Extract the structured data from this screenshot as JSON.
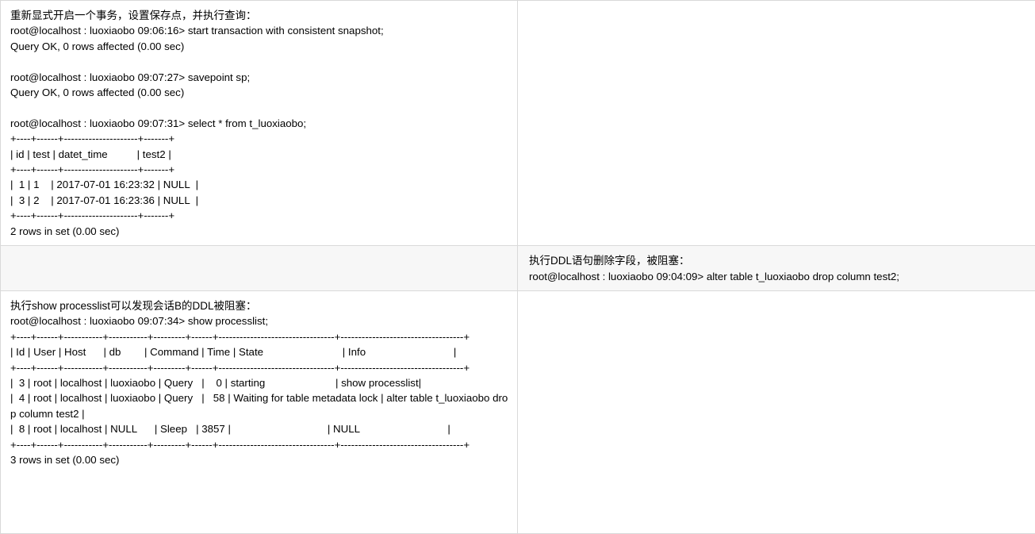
{
  "layout": {
    "kind": "two-column-comparison-table",
    "columns": [
      "session-a",
      "session-b"
    ],
    "rows": 3,
    "border_color": "#d9d9d9",
    "highlight_row_bg": "#f7f7f7"
  },
  "session_a": {
    "step1": {
      "note": "重新显式开启一个事务，设置保存点，并执行查询：",
      "terminal": "root@localhost : luoxiaobo 09:06:16> start transaction with consistent snapshot;\nQuery OK, 0 rows affected (0.00 sec)\n\nroot@localhost : luoxiaobo 09:07:27> savepoint sp;\nQuery OK, 0 rows affected (0.00 sec)\n\nroot@localhost : luoxiaobo 09:07:31> select * from t_luoxiaobo;\n+----+------+---------------------+-------+\n| id | test | datet_time          | test2 |\n+----+------+---------------------+-------+\n|  1 | 1    | 2017-07-01 16:23:32 | NULL  |\n|  3 | 2    | 2017-07-01 16:23:36 | NULL  |\n+----+------+---------------------+-------+\n2 rows in set (0.00 sec)"
    },
    "step2": {
      "note": "",
      "terminal": ""
    },
    "step3": {
      "note": "执行show processlist可以发现会话B的DDL被阻塞：",
      "terminal": "root@localhost : luoxiaobo 09:07:34> show processlist;\n+----+------+-----------+-----------+---------+------+---------------------------------+-----------------------------------+\n| Id | User | Host      | db        | Command | Time | State                           | Info                              |\n+----+------+-----------+-----------+---------+------+---------------------------------+-----------------------------------+\n|  3 | root | localhost | luoxiaobo | Query   |    0 | starting                        | show processlist|\n|  4 | root | localhost | luoxiaobo | Query   |   58 | Waiting for table metadata lock | alter table t_luoxiaobo drop column test2 |\n|  8 | root | localhost | NULL      | Sleep   | 3857 |                                 | NULL                              |\n+----+------+-----------+-----------+---------+------+---------------------------------+-----------------------------------+\n3 rows in set (0.00 sec)"
    }
  },
  "session_b": {
    "step1": {
      "note": "",
      "terminal": ""
    },
    "step2": {
      "note": "执行DDL语句删除字段，被阻塞：",
      "terminal": "root@localhost : luoxiaobo 09:04:09> alter table t_luoxiaobo drop column test2;"
    },
    "step3": {
      "note": "",
      "terminal": ""
    }
  }
}
